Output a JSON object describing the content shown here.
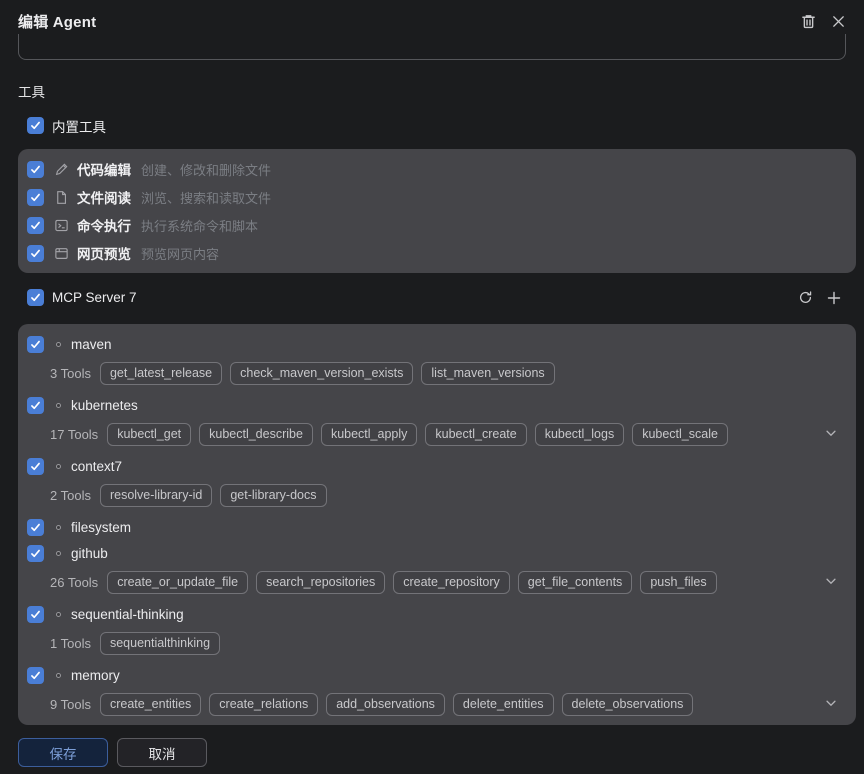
{
  "dialog": {
    "title": "编辑 Agent",
    "header_icons": [
      "trash-icon",
      "close-icon"
    ],
    "prompt_value": "",
    "save_label": "保存",
    "cancel_label": "取消"
  },
  "tools_section": {
    "label": "工具",
    "builtin_group_label": "内置工具",
    "builtin_group_checked": true,
    "builtin_tools": [
      {
        "name": "代码编辑",
        "description": "创建、修改和删除文件",
        "icon": "pencil-icon",
        "checked": true
      },
      {
        "name": "文件阅读",
        "description": "浏览、搜索和读取文件",
        "icon": "file-icon",
        "checked": true
      },
      {
        "name": "命令执行",
        "description": "执行系统命令和脚本",
        "icon": "terminal-icon",
        "checked": true
      },
      {
        "name": "网页预览",
        "description": "预览网页内容",
        "icon": "browser-icon",
        "checked": true
      }
    ]
  },
  "mcp_section": {
    "label": "MCP Server 7",
    "checked": true,
    "action_icons": [
      "refresh-icon",
      "add-icon"
    ],
    "servers": [
      {
        "name": "maven",
        "checked": true,
        "tools_count": "3 Tools",
        "expandable": false,
        "tools": [
          "get_latest_release",
          "check_maven_version_exists",
          "list_maven_versions"
        ]
      },
      {
        "name": "kubernetes",
        "checked": true,
        "tools_count": "17 Tools",
        "expandable": true,
        "tools": [
          "kubectl_get",
          "kubectl_describe",
          "kubectl_apply",
          "kubectl_create",
          "kubectl_logs",
          "kubectl_scale"
        ]
      },
      {
        "name": "context7",
        "checked": true,
        "tools_count": "2 Tools",
        "expandable": false,
        "tools": [
          "resolve-library-id",
          "get-library-docs"
        ]
      },
      {
        "name": "filesystem",
        "checked": true,
        "tools_count": null,
        "expandable": false,
        "tools": []
      },
      {
        "name": "github",
        "checked": true,
        "tools_count": "26 Tools",
        "expandable": true,
        "tools": [
          "create_or_update_file",
          "search_repositories",
          "create_repository",
          "get_file_contents",
          "push_files"
        ]
      },
      {
        "name": "sequential-thinking",
        "checked": true,
        "tools_count": "1 Tools",
        "expandable": false,
        "tools": [
          "sequentialthinking"
        ]
      },
      {
        "name": "memory",
        "checked": true,
        "tools_count": "9 Tools",
        "expandable": true,
        "tools": [
          "create_entities",
          "create_relations",
          "add_observations",
          "delete_entities",
          "delete_observations"
        ]
      }
    ]
  },
  "colors": {
    "background": "#1b1c1e",
    "panel": "#454549",
    "checkbox_accent": "#4a7ed6",
    "save_button_border": "#3c5e9c",
    "save_button_text": "#7d9fd8",
    "tag_border": "#737378",
    "muted_text": "#7b7e84"
  }
}
